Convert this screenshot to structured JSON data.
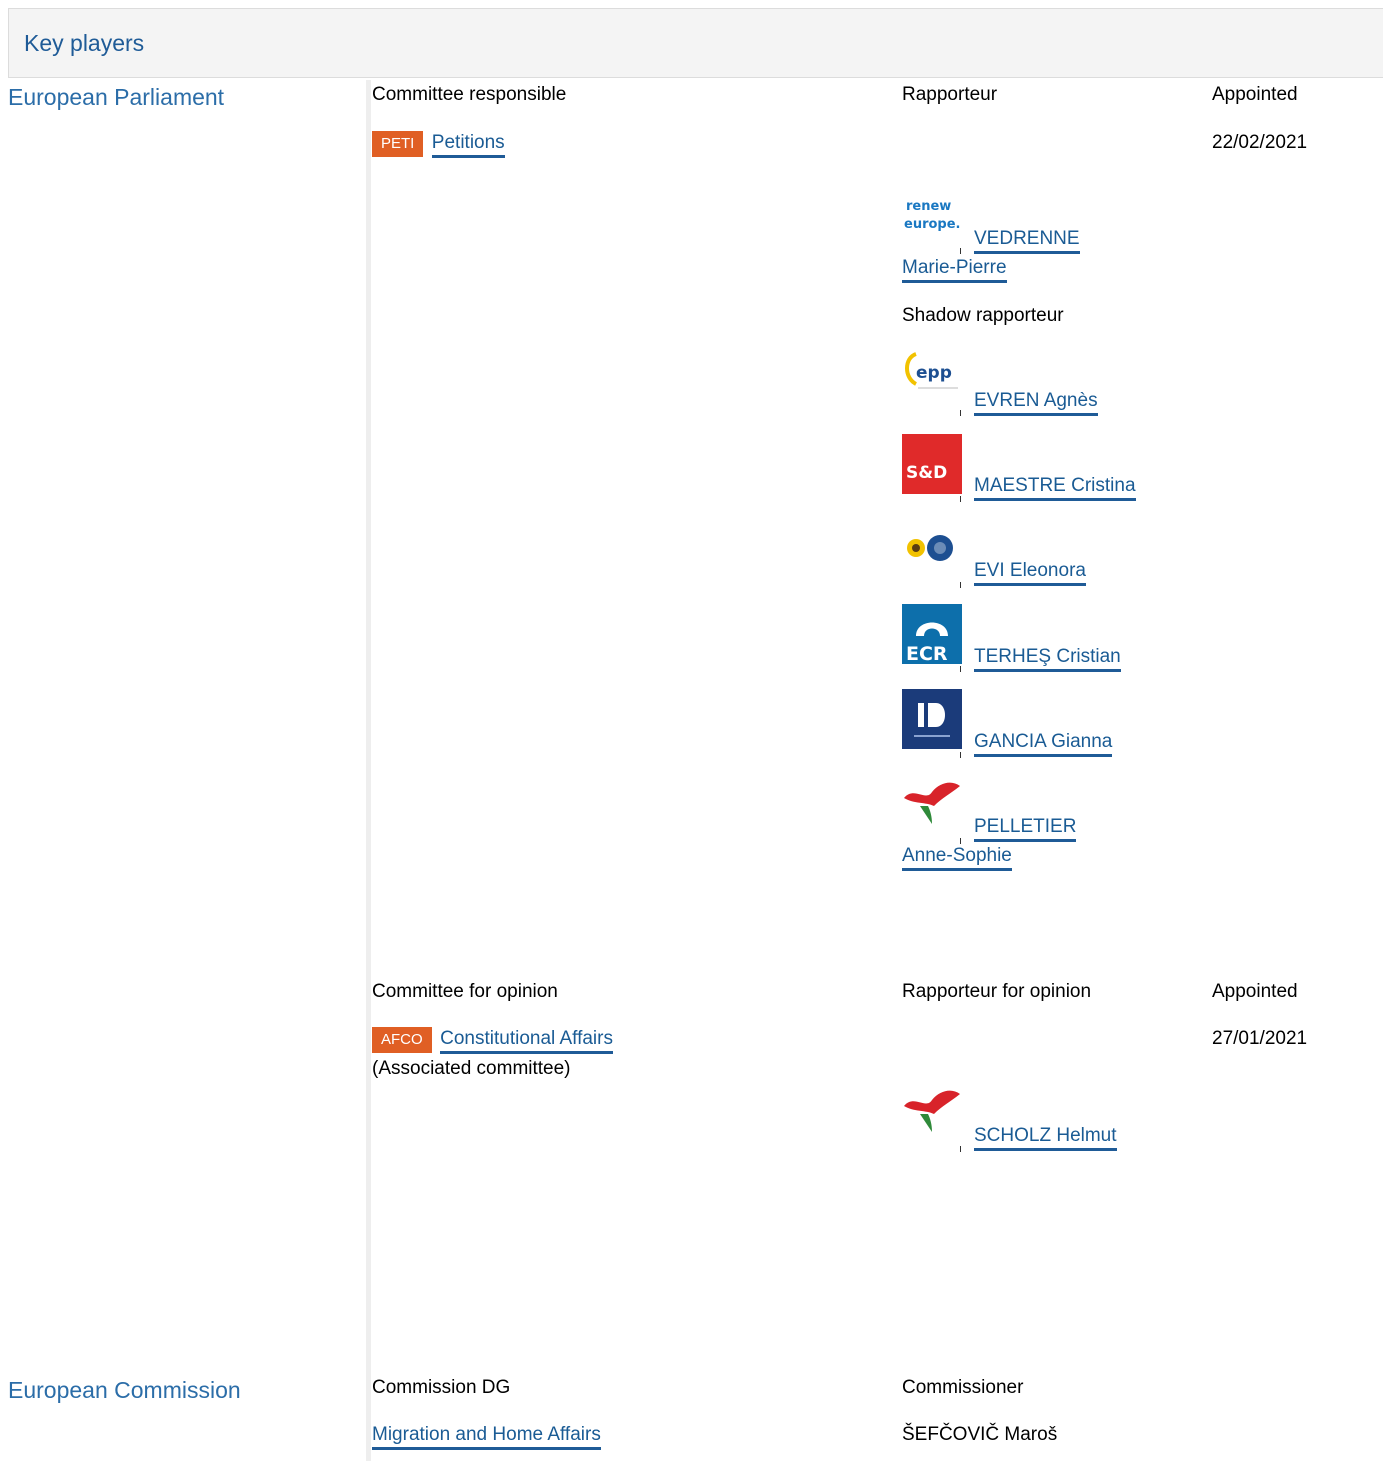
{
  "header": {
    "title": "Key players"
  },
  "parliament": {
    "institution": "European Parliament",
    "responsible": {
      "heading": "Committee responsible",
      "badge": "PETI",
      "committee": "Petitions",
      "rapporteur_heading": "Rapporteur",
      "appointed_heading": "Appointed",
      "appointed_date": "22/02/2021",
      "rapporteur": {
        "group_icon": "renew-europe-logo",
        "name_line1": "VEDRENNE",
        "name_line2": "Marie-Pierre"
      },
      "shadow_heading": "Shadow rapporteur",
      "shadows": [
        {
          "group_icon": "epp-logo",
          "name": "EVREN Agnès"
        },
        {
          "group_icon": "s-and-d-logo",
          "name": "MAESTRE Cristina"
        },
        {
          "group_icon": "greens-efa-logo",
          "name": "EVI Eleonora"
        },
        {
          "group_icon": "ecr-logo",
          "name": "TERHEŞ Cristian"
        },
        {
          "group_icon": "id-logo",
          "name": "GANCIA Gianna"
        },
        {
          "group_icon": "left-logo",
          "name_line1": "PELLETIER",
          "name_line2": "Anne-Sophie"
        }
      ]
    },
    "opinion": {
      "heading": "Committee for opinion",
      "badge": "AFCO",
      "committee": "Constitutional Affairs",
      "note": "(Associated committee)",
      "rapporteur_heading": "Rapporteur for opinion",
      "appointed_heading": "Appointed",
      "appointed_date": "27/01/2021",
      "rapporteur": {
        "group_icon": "left-logo",
        "name": "SCHOLZ Helmut"
      }
    }
  },
  "commission": {
    "institution": "European Commission",
    "dg_heading": "Commission DG",
    "dg": "Migration and Home Affairs",
    "commissioner_heading": "Commissioner",
    "commissioner": "ŠEFČOVIČ Maroš"
  },
  "colors": {
    "accent": "#1f5b97",
    "badge": "#e05f24"
  }
}
